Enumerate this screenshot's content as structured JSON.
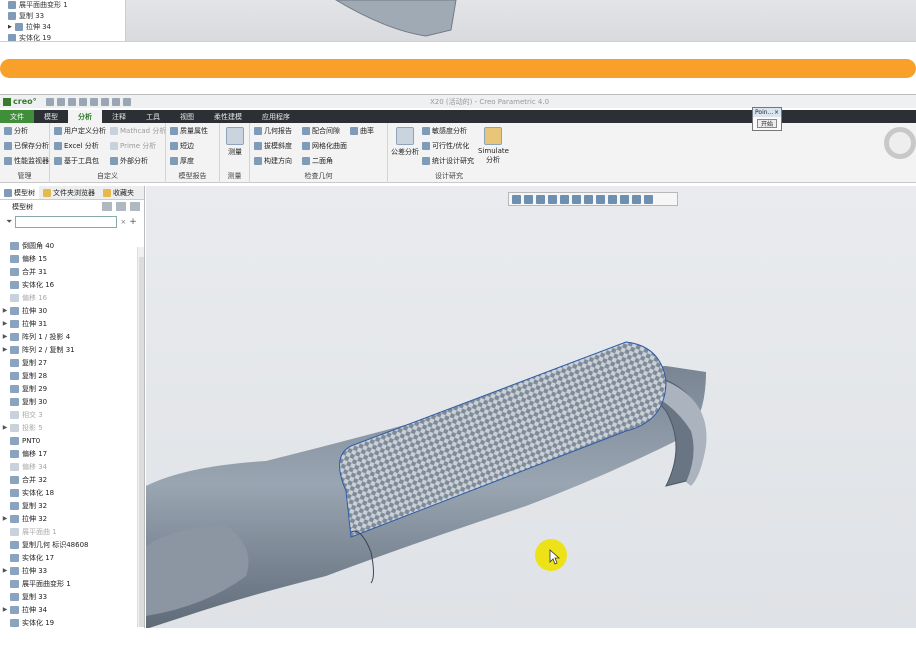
{
  "top_crop": {
    "rows": [
      {
        "label": "展平面曲变形 1"
      },
      {
        "label": "复制 33"
      },
      {
        "label": "拉伸 34"
      },
      {
        "label": "实体化 19"
      }
    ]
  },
  "window": {
    "logo": "creo°",
    "title": "X20 (活动的) - Creo Parametric 4.0"
  },
  "ribbon_tabs": [
    "文件",
    "模型",
    "分析",
    "注释",
    "工具",
    "视图",
    "柔性建模",
    "应用程序"
  ],
  "ribbon": {
    "manage": {
      "items": [
        "分析",
        "已保存分析",
        "性能监视器"
      ],
      "label": "管理"
    },
    "custom": {
      "items": [
        "用户定义分析",
        "Excel 分析",
        "基于工具包",
        "Mathcad 分析",
        "Prime 分析",
        "外部分析"
      ],
      "label": "自定义"
    },
    "model_report": {
      "items": [
        "质量属性",
        "短边",
        "厚度"
      ],
      "label": "模型报告"
    },
    "measure": {
      "label": "测量",
      "big": "测量"
    },
    "check_geometry": {
      "items": [
        "几何报告",
        "拔模斜度",
        "构建方向",
        "配合间隙",
        "网格化曲面",
        "二面角",
        "曲率"
      ],
      "label": "检查几何"
    },
    "design_study": {
      "items": [
        "敏感度分析",
        "可行性/优化",
        "统计设计研究"
      ],
      "big1": "公差分析",
      "big2": "Simulate 分析",
      "label": "设计研究"
    }
  },
  "popup": {
    "title": "Poin...",
    "button": "开始"
  },
  "sidebar": {
    "tabs": [
      "模型树",
      "文件夹浏览器",
      "收藏夹"
    ],
    "header": "模型树",
    "tree": [
      {
        "label": "倒圆角 40",
        "arrow": "",
        "dim": false
      },
      {
        "label": "偏移 15",
        "arrow": "",
        "dim": false
      },
      {
        "label": "合并 31",
        "arrow": "",
        "dim": false
      },
      {
        "label": "实体化 16",
        "arrow": "",
        "dim": false
      },
      {
        "label": "偏移 16",
        "arrow": "",
        "dim": true
      },
      {
        "label": "拉伸 30",
        "arrow": "▶",
        "dim": false
      },
      {
        "label": "拉伸 31",
        "arrow": "▶",
        "dim": false
      },
      {
        "label": "阵列 1 / 投影 4",
        "arrow": "▶",
        "dim": false
      },
      {
        "label": "阵列 2 / 复制 31",
        "arrow": "▶",
        "dim": false
      },
      {
        "label": "复制 27",
        "arrow": "",
        "dim": false
      },
      {
        "label": "复制 28",
        "arrow": "",
        "dim": false
      },
      {
        "label": "复制 29",
        "arrow": "",
        "dim": false
      },
      {
        "label": "复制 30",
        "arrow": "",
        "dim": false
      },
      {
        "label": "相交 3",
        "arrow": "",
        "dim": true
      },
      {
        "label": "投影 5",
        "arrow": "▶",
        "dim": true
      },
      {
        "label": "PNT0",
        "arrow": "",
        "dim": false
      },
      {
        "label": "偏移 17",
        "arrow": "",
        "dim": false
      },
      {
        "label": "偏移 34",
        "arrow": "",
        "dim": true
      },
      {
        "label": "合并 32",
        "arrow": "",
        "dim": false
      },
      {
        "label": "实体化 18",
        "arrow": "",
        "dim": false
      },
      {
        "label": "复制 32",
        "arrow": "",
        "dim": false
      },
      {
        "label": "拉伸 32",
        "arrow": "▶",
        "dim": false
      },
      {
        "label": "展平面曲 1",
        "arrow": "",
        "dim": true
      },
      {
        "label": "复制几何 标识48608",
        "arrow": "",
        "dim": false
      },
      {
        "label": "实体化 17",
        "arrow": "",
        "dim": false
      },
      {
        "label": "拉伸 33",
        "arrow": "▶",
        "dim": false
      },
      {
        "label": "展平面曲变形 1",
        "arrow": "",
        "dim": false
      },
      {
        "label": "复制 33",
        "arrow": "",
        "dim": false
      },
      {
        "label": "拉伸 34",
        "arrow": "▶",
        "dim": false
      },
      {
        "label": "实体化 19",
        "arrow": "",
        "dim": false
      }
    ]
  },
  "colors": {
    "accent_orange": "#f8a02a",
    "ribbon_dark": "#2c3034",
    "file_tab": "#3f8f3a",
    "model_gray": "#8c98a6",
    "cursor_highlight": "#eee100"
  },
  "icons": [
    "search-icon",
    "settings-icon",
    "filter-icon",
    "add-icon",
    "clear-icon",
    "gear-icon",
    "cursor-icon"
  ]
}
